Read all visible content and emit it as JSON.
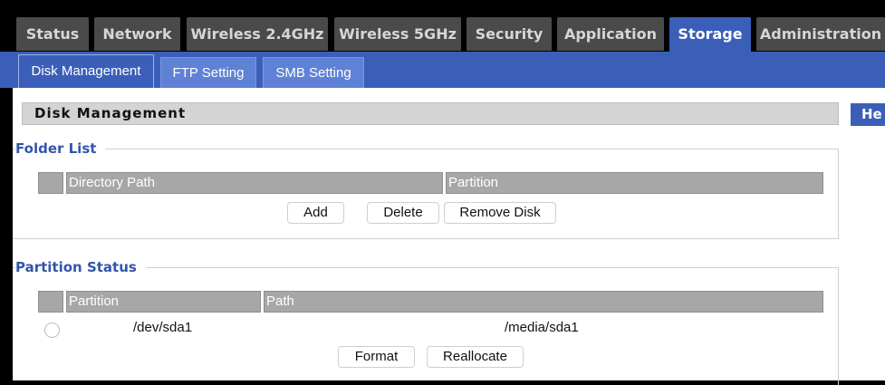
{
  "top_nav": {
    "tabs": [
      {
        "label": "Status"
      },
      {
        "label": "Network"
      },
      {
        "label": "Wireless 2.4GHz"
      },
      {
        "label": "Wireless 5GHz"
      },
      {
        "label": "Security"
      },
      {
        "label": "Application"
      },
      {
        "label": "Storage",
        "active": true
      },
      {
        "label": "Administration"
      }
    ]
  },
  "sub_nav": {
    "tabs": [
      {
        "label": "Disk Management",
        "active": true
      },
      {
        "label": "FTP Setting"
      },
      {
        "label": "SMB Setting"
      }
    ]
  },
  "page": {
    "section_title": "Disk Management",
    "help_label": "He"
  },
  "folder_list": {
    "legend": "Folder List",
    "columns": [
      "",
      "Directory Path",
      "Partition"
    ],
    "buttons": {
      "add": "Add",
      "delete": "Delete",
      "remove_disk": "Remove Disk"
    }
  },
  "partition_status": {
    "legend": "Partition Status",
    "columns": [
      "",
      "Partition",
      "Path"
    ],
    "rows": [
      {
        "partition": "/dev/sda1",
        "path": "/media/sda1",
        "selected": false
      }
    ],
    "buttons": {
      "format": "Format",
      "reallocate": "Reallocate"
    }
  },
  "colors": {
    "accent": "#3b5fb8",
    "tab_inactive": "#4a4a4a",
    "legend_text": "#3355aa",
    "table_header": "#a7a7a7"
  }
}
